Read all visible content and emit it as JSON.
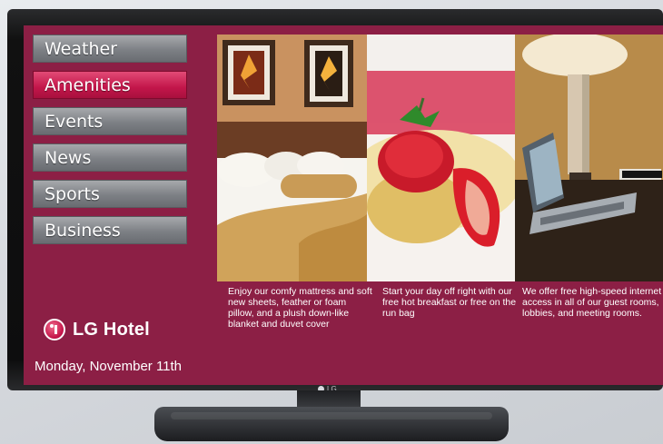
{
  "menu": {
    "items": [
      {
        "label": "Weather"
      },
      {
        "label": "Amenities",
        "active": true
      },
      {
        "label": "Events"
      },
      {
        "label": "News"
      },
      {
        "label": "Sports"
      },
      {
        "label": "Business"
      }
    ]
  },
  "captions": [
    "Enjoy our comfy mattress and soft new sheets, feather or foam pillow, and a plush down-like blanket and duvet cover",
    "Start your day off right with our free hot breakfast or free on the run bag",
    "We offer free high-speed internet access in all of our guest rooms, lobbies, and meeting rooms."
  ],
  "brand": {
    "name": "LG Hotel"
  },
  "date": "Monday, November 11th",
  "tv": {
    "logo_text": "LG"
  },
  "colors": {
    "background": "#8c1f45",
    "active_button": "#c3164a",
    "button": "#7d8085"
  },
  "icons": {
    "brand": "lg-logo-icon",
    "tv": "lg-tv-logo-icon"
  }
}
